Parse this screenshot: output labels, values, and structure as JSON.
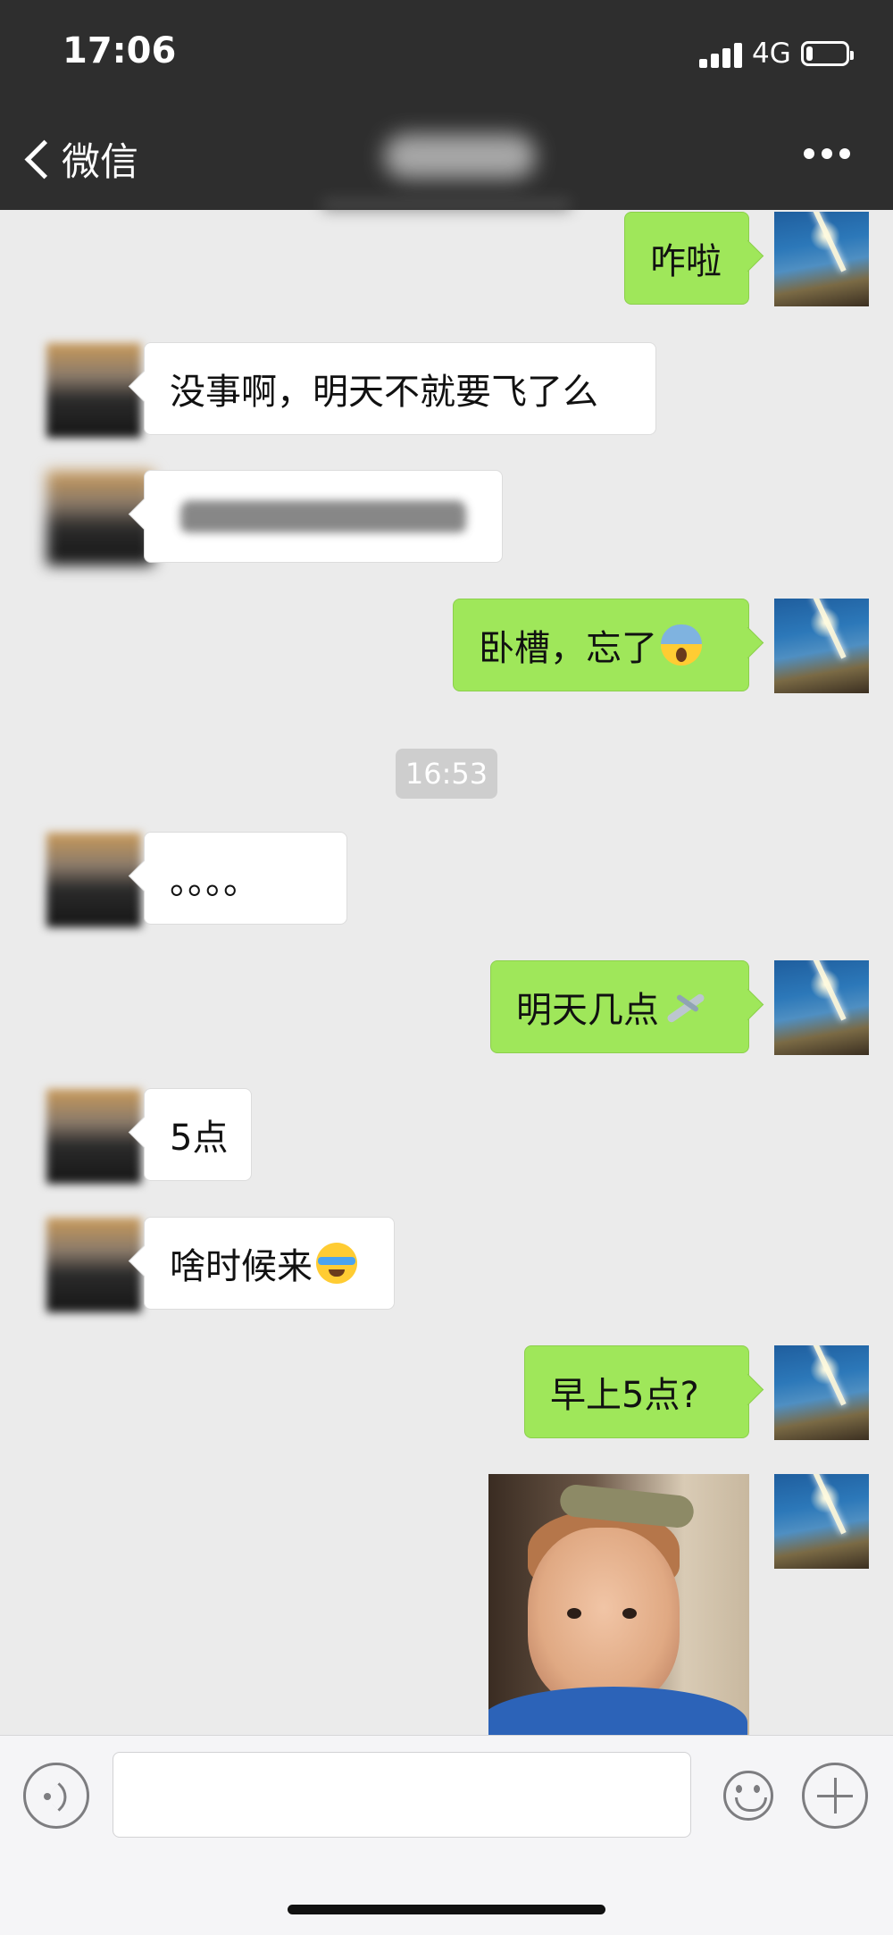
{
  "status_bar": {
    "time": "17:06",
    "network": "4G",
    "battery_level": 0.15
  },
  "nav": {
    "back_label": "微信"
  },
  "messages": [
    {
      "side": "out",
      "text": "咋啦"
    },
    {
      "side": "in",
      "text": "没事啊，明天不就要飞了么"
    },
    {
      "side": "in",
      "text": ""
    },
    {
      "side": "out",
      "text": "卧槽，忘了",
      "emoji": "face-screaming-icon"
    },
    {
      "side": "in",
      "text": "。。。。"
    },
    {
      "side": "out",
      "text": "明天几点",
      "emoji": "airplane-icon"
    },
    {
      "side": "in",
      "text": "5点"
    },
    {
      "side": "in",
      "text": "啥时候来",
      "emoji": "loudly-crying-face-icon"
    },
    {
      "side": "out",
      "text": "早上5点?"
    }
  ],
  "timestamp": "16:53",
  "input_bar": {
    "placeholder": ""
  },
  "colors": {
    "nav_bg": "#2e2e2e",
    "chat_bg": "#ebebeb",
    "outgoing_bubble": "#9fe75a",
    "incoming_bubble": "#ffffff"
  }
}
